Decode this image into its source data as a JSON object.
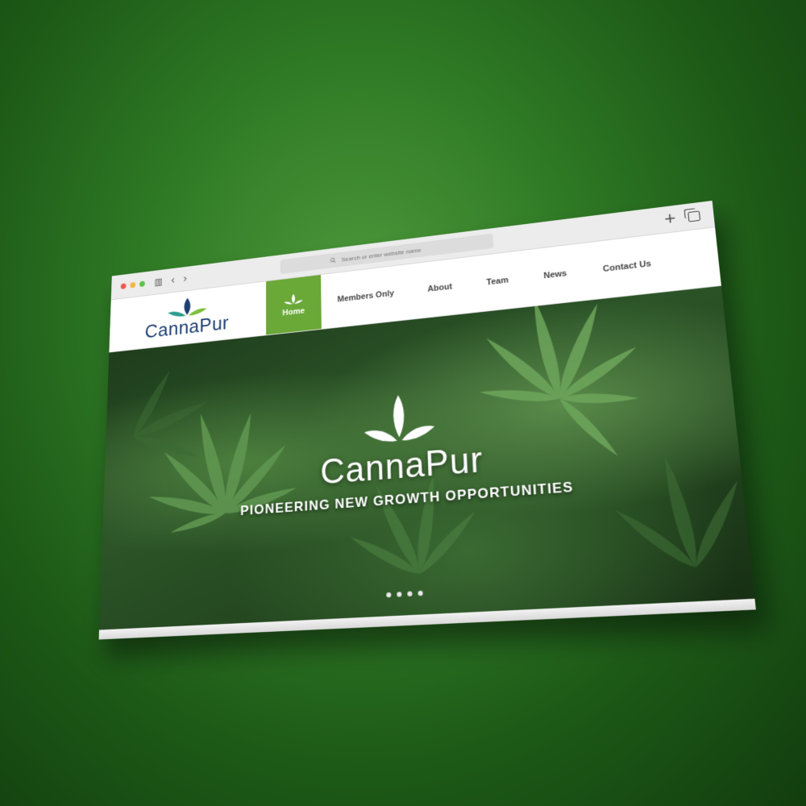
{
  "browser": {
    "address_placeholder": "Search or enter website name",
    "new_tab_symbol": "+",
    "back_symbol": "‹",
    "forward_symbol": "›",
    "sidebar_symbol": "▥"
  },
  "site": {
    "logo_text": "CannaPur",
    "nav": [
      {
        "label": "Home",
        "active": true
      },
      {
        "label": "Members Only"
      },
      {
        "label": "About"
      },
      {
        "label": "Team"
      },
      {
        "label": "News"
      },
      {
        "label": "Contact Us"
      }
    ],
    "accent_color": "#6aa838",
    "brand_blue": "#1f3f73"
  },
  "hero": {
    "title": "CannaPur",
    "tagline": "PIONEERING NEW GROWTH OPPORTUNITIES",
    "slide_count": 4,
    "active_slide": 1
  }
}
